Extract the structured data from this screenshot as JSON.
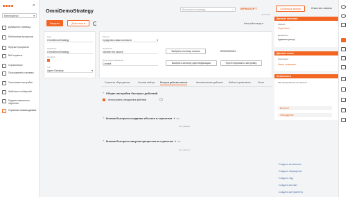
{
  "sidebar": {
    "workspace": "Конструктор",
    "items": [
      {
        "label": "Домашняя страница",
        "icon": "home-icon"
      },
      {
        "label": "Библиотека процессов",
        "icon": "library-icon"
      },
      {
        "label": "Журнал процессов",
        "icon": "journal-icon"
      },
      {
        "label": "Веб сервисы",
        "icon": "globe-icon"
      },
      {
        "label": "Справочники",
        "icon": "book-icon"
      },
      {
        "label": "Пользователи системы",
        "icon": "users-icon"
      },
      {
        "label": "Системные настройки",
        "icon": "settings-icon"
      },
      {
        "label": "Шаблоны сообщений",
        "icon": "template-icon"
      },
      {
        "label": "Модели машинного обучения",
        "icon": "ml-icon"
      },
      {
        "label": "Стратегии поиска данных",
        "icon": "strategy-icon"
      }
    ]
  },
  "header": {
    "title": "OmniDemoStrategy",
    "search_placeholder": "Выполнить команду",
    "brand": "BPMSOFT",
    "brand_sub": "ЭКСПЕРТ",
    "close_label": "Закрыть",
    "actions_label": "Действия",
    "view_settings": "Настройка вида"
  },
  "form": {
    "code_label": "Код",
    "code_value": "OmniDemoStrategy",
    "name_label": "Название",
    "name_value": "OmniDemoStrategy",
    "active_label": "Активна",
    "type_label": "Тип",
    "type_value": "Agent Desktop",
    "object_label": "Объект",
    "object_value": "Средство связи контакта",
    "search_label": "Приемник",
    "search_value": "Number for search",
    "ident_label": "Поле идентификации",
    "ident_value": "Contact",
    "phone_value": "89992050054",
    "btn_select_search": "Выбрать колонку поиска",
    "btn_select_ident": "Выбрать колонку идентификации",
    "btn_test": "Протестировать настройку"
  },
  "tabs": [
    "Стратегии сбора данных",
    "Условия выбора",
    "Быстрые действия панели",
    "Автоматические действия",
    "Файлы и примечания",
    "Лента"
  ],
  "sections": {
    "s1_title": "Общие настройки быстрых действий",
    "s1_checkbox": "Использовать стандартные действия",
    "s2_title": "Кнопка быстрого создания объекта в стратегии",
    "s2_empty": "Нет данных",
    "s3_title": "Кнопка быстрого запуска процессов в стратегии",
    "s3_empty": "Нет данных"
  },
  "right_panel": {
    "btn_page": "Страница звонка",
    "btn_clear": "Очистить панель",
    "contact_head": "Данные контакта",
    "contact_lbl": "Контакт",
    "contact_val": "Supervisor",
    "position_lbl": "Должность",
    "position_val": "Администратор",
    "account_head": "Данные счета",
    "account_lbl": "Контрагент",
    "account_val": "Наше компания",
    "activity_head": "Активности",
    "activity_lbl": "Запланированные активности",
    "activity_items": [
      "Встречи",
      "Обсуждение"
    ],
    "links": [
      "Создать активность",
      "Создать обращение",
      "Создать лид",
      "Создать контакт",
      "Создать контрагента"
    ]
  },
  "colors": {
    "accent": "#f26522"
  }
}
